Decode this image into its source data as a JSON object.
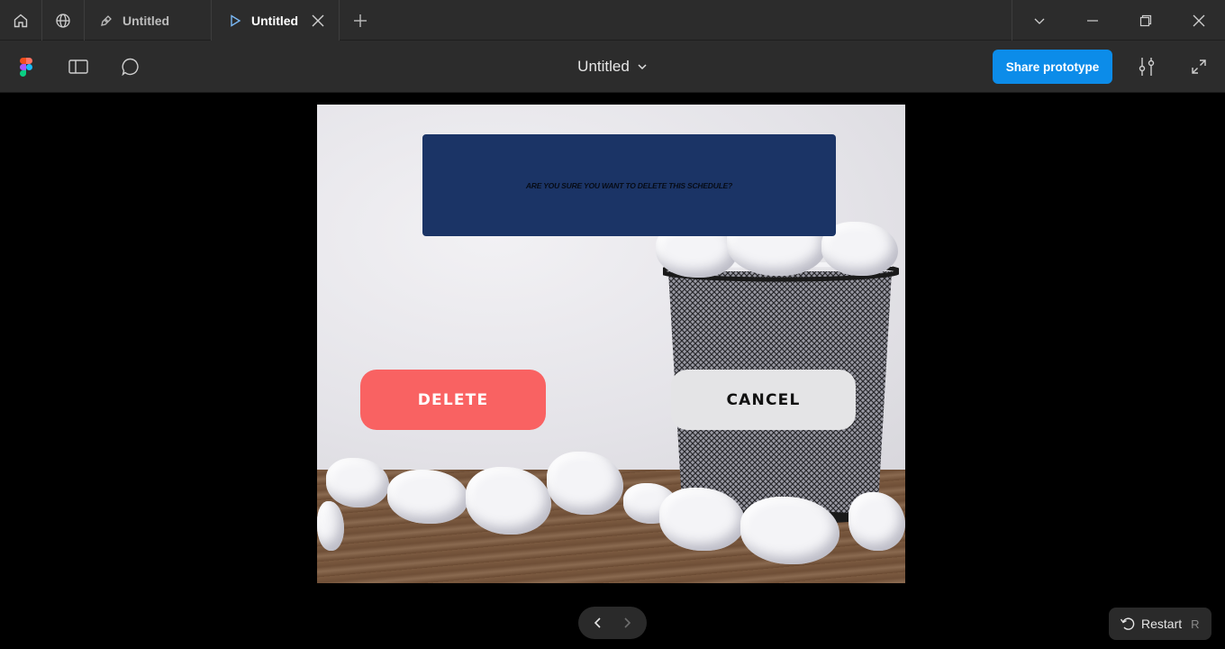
{
  "tabbar": {
    "tabs": [
      {
        "label": "Untitled",
        "icon": "pen-icon",
        "active": false
      },
      {
        "label": "Untitled",
        "icon": "play-icon",
        "active": true
      }
    ]
  },
  "toolbar": {
    "file_title": "Untitled",
    "share_label": "Share prototype"
  },
  "prototype": {
    "dialog_text": "ARE YOU SURE  YOU  WANT TO DELETE THIS SCHEDULE?",
    "delete_label": "DELETE",
    "cancel_label": "CANCEL",
    "colors": {
      "dialog": "#1b3466",
      "delete": "#f96262",
      "cancel": "#e4e4e6",
      "accent": "#0c8ce9"
    }
  },
  "footer": {
    "restart_label": "Restart",
    "restart_shortcut": "R"
  }
}
